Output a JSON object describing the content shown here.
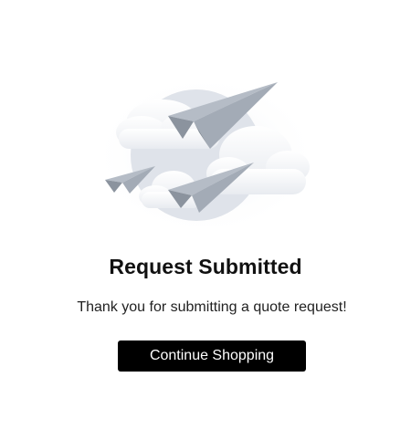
{
  "dialog": {
    "title": "Request Submitted",
    "message": "Thank you for submitting a quote request!",
    "continue_label": "Continue Shopping"
  },
  "illustration": {
    "icon": "paper-planes-clouds-illustration",
    "colors": {
      "plane_light": "#b5bcc6",
      "plane_dark": "#8b939e",
      "cloud": "#f1f3f6",
      "circle": "#dfe3ea"
    }
  },
  "colors": {
    "button_bg": "#000000",
    "button_text": "#ffffff",
    "title_text": "#111111"
  }
}
